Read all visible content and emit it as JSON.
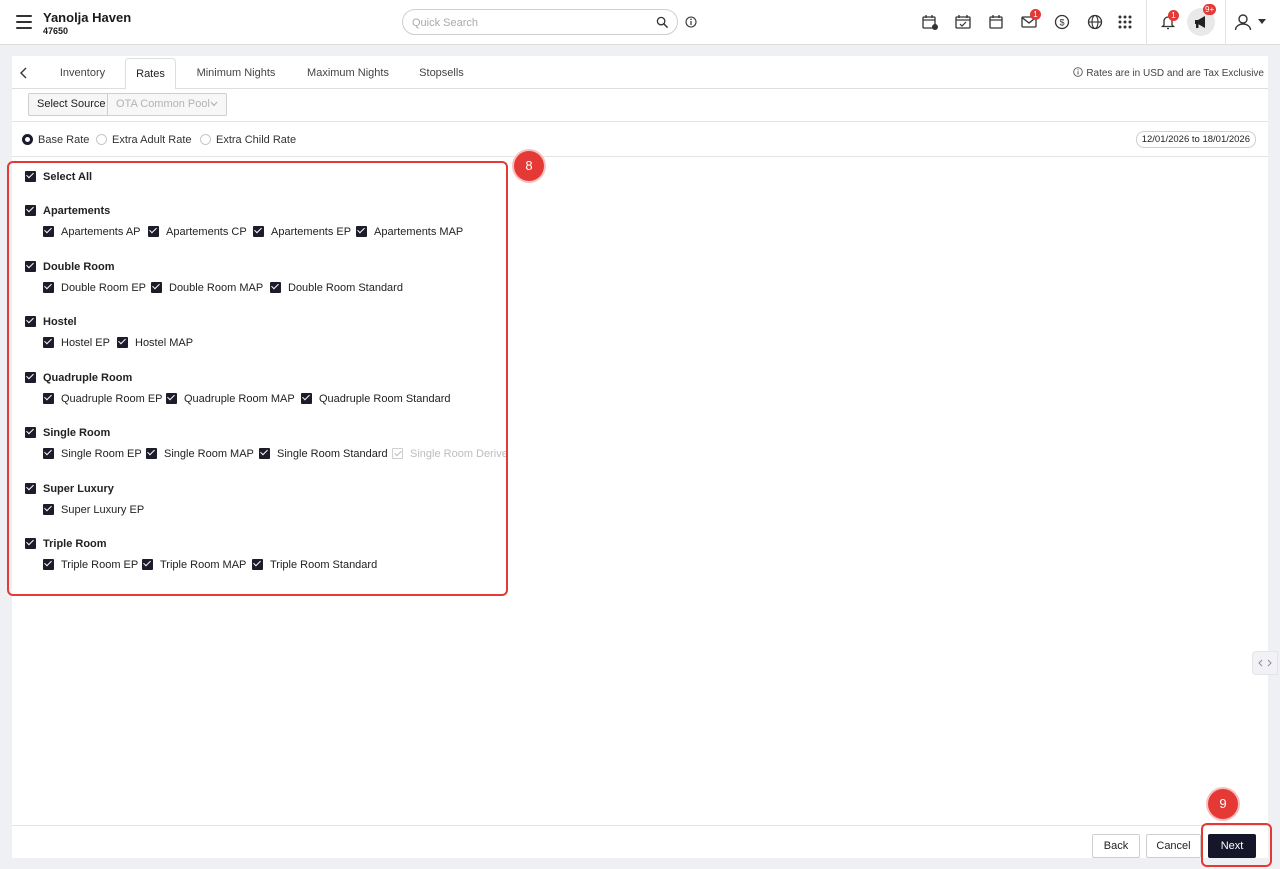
{
  "header": {
    "property_name": "Yanolja Haven",
    "property_code": "47650",
    "search_placeholder": "Quick Search",
    "mail_badge": "1",
    "notification_badge": "1",
    "announcement_badge": "9+"
  },
  "tabs": [
    "Inventory",
    "Rates",
    "Minimum Nights",
    "Maximum Nights",
    "Stopsells"
  ],
  "active_tab": "Rates",
  "rates_note": "Rates are in USD and are Tax Exclusive",
  "source": {
    "label": "Select Source",
    "value": "OTA Common Pool"
  },
  "rate_types": [
    {
      "label": "Base Rate",
      "selected": true
    },
    {
      "label": "Extra Adult Rate",
      "selected": false
    },
    {
      "label": "Extra Child Rate",
      "selected": false
    }
  ],
  "date_range": "12/01/2026 to 18/01/2026",
  "select_all": "Select All",
  "groups": [
    {
      "name": "Apartements",
      "plans": [
        "Apartements AP",
        "Apartements CP",
        "Apartements EP",
        "Apartements MAP"
      ]
    },
    {
      "name": "Double Room",
      "plans": [
        "Double Room EP",
        "Double Room MAP",
        "Double Room Standard"
      ]
    },
    {
      "name": "Hostel",
      "plans": [
        "Hostel EP",
        "Hostel MAP"
      ]
    },
    {
      "name": "Quadruple Room",
      "plans": [
        "Quadruple Room EP",
        "Quadruple Room MAP",
        "Quadruple Room Standard"
      ]
    },
    {
      "name": "Single Room",
      "plans": [
        "Single Room EP",
        "Single Room MAP",
        "Single Room Standard",
        "Single Room Derived"
      ]
    },
    {
      "name": "Super Luxury",
      "plans": [
        "Super Luxury EP"
      ]
    },
    {
      "name": "Triple Room",
      "plans": [
        "Triple Room EP",
        "Triple Room MAP",
        "Triple Room Standard"
      ]
    }
  ],
  "step_badges": [
    "8",
    "9"
  ],
  "buttons": {
    "back": "Back",
    "cancel": "Cancel",
    "next": "Next"
  },
  "colors": {
    "accent_dark": "#16162a",
    "annotation_red": "#e53935"
  }
}
